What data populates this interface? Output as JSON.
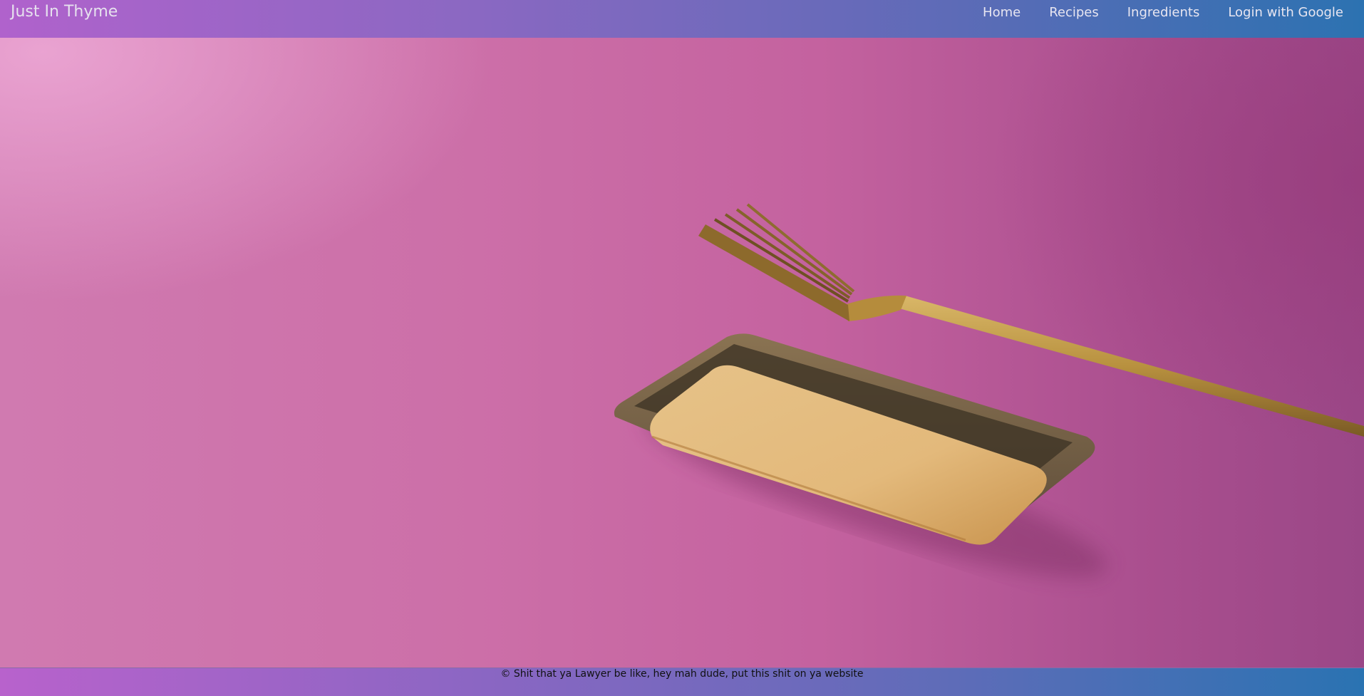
{
  "navbar": {
    "brand": "Just In Thyme",
    "links": [
      {
        "label": "Home"
      },
      {
        "label": "Recipes"
      },
      {
        "label": "Ingredients"
      },
      {
        "label": "Login with Google"
      }
    ]
  },
  "footer": {
    "text": "© Shit that ya Lawyer be like, hey mah dude, put this shit on ya website"
  },
  "colors": {
    "nav_gradient_start": "#b062cc",
    "nav_gradient_end": "#2c72b1",
    "hero_background": "#cc6fa8"
  }
}
